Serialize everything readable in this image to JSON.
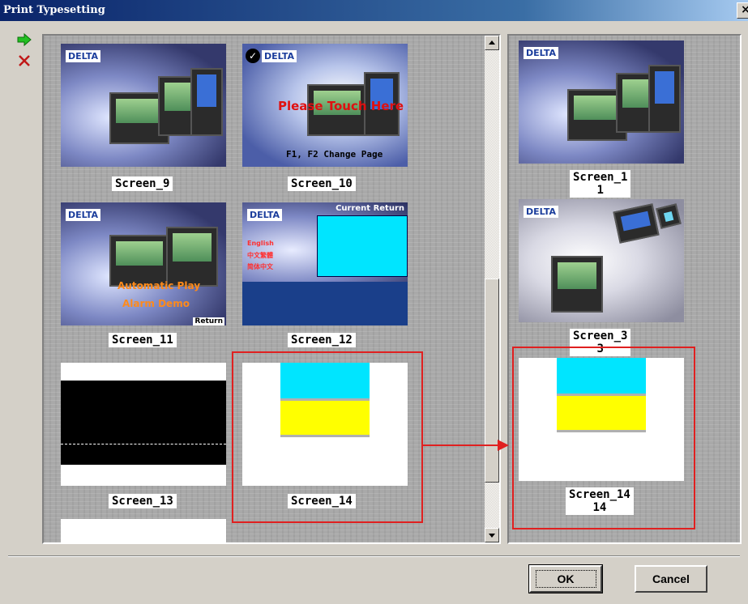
{
  "window": {
    "title": "Print Typesetting",
    "close_glyph": "×"
  },
  "toolbar": {
    "add_icon": "arrow-right-icon",
    "remove_icon": "x-icon"
  },
  "left_panel": {
    "screens": [
      {
        "name": "Screen_9"
      },
      {
        "name": "Screen_10",
        "overlay": "Please Touch Here",
        "footer": "F1, F2 Change Page"
      },
      {
        "name": "Screen_11",
        "overlay1": "Automatic Play",
        "overlay2": "Alarm Demo",
        "footer": "Return"
      },
      {
        "name": "Screen_12",
        "header": "Current Return",
        "menu": [
          "English",
          "中文繁體",
          "简体中文"
        ]
      },
      {
        "name": "Screen_13"
      },
      {
        "name": "Screen_14"
      }
    ]
  },
  "right_panel": {
    "screens": [
      {
        "name": "Screen_1",
        "number": "1"
      },
      {
        "name": "Screen_3",
        "number": "3"
      },
      {
        "name": "Screen_14",
        "number": "14"
      }
    ]
  },
  "logo_text": "DELTA",
  "buttons": {
    "ok": "OK",
    "cancel": "Cancel"
  },
  "colors": {
    "highlight": "#e02020",
    "cyan": "#00e5ff",
    "yellow": "#ffff00"
  }
}
